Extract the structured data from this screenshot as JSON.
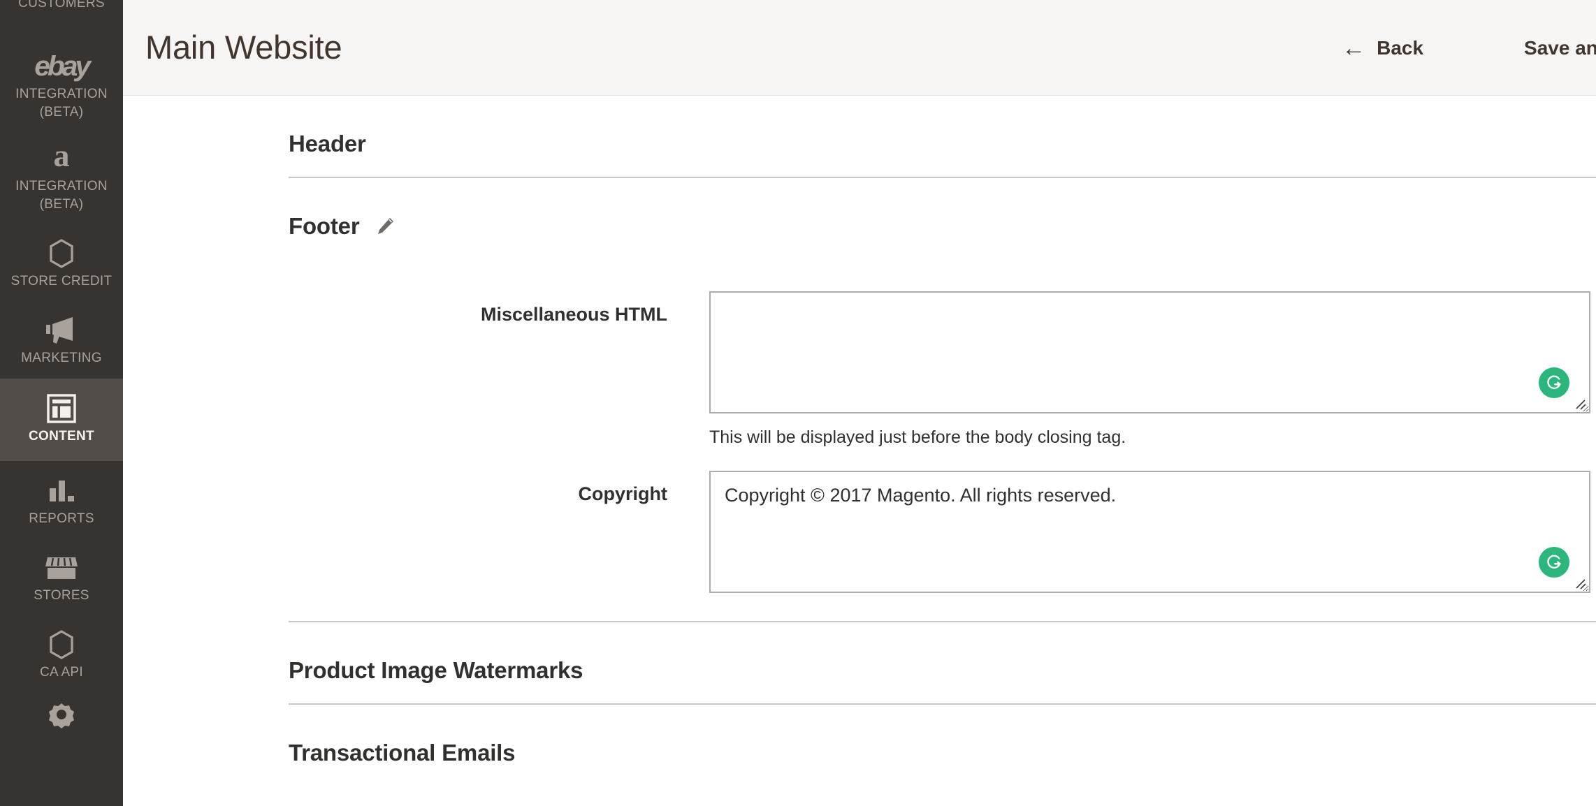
{
  "sidebar": {
    "items": [
      {
        "label": "CUSTOMERS",
        "icon": "customers-icon",
        "active": false,
        "partial_top": true
      },
      {
        "label": "INTEGRATION\n(BETA)",
        "icon": "ebay-logo-icon",
        "active": false
      },
      {
        "label": "INTEGRATION\n(BETA)",
        "icon": "amazon-logo-icon",
        "active": false
      },
      {
        "label": "STORE CREDIT",
        "icon": "hexagon-icon",
        "active": false
      },
      {
        "label": "MARKETING",
        "icon": "megaphone-icon",
        "active": false
      },
      {
        "label": "CONTENT",
        "icon": "content-layout-icon",
        "active": true
      },
      {
        "label": "REPORTS",
        "icon": "bar-chart-icon",
        "active": false
      },
      {
        "label": "STORES",
        "icon": "storefront-icon",
        "active": false
      },
      {
        "label": "CA API",
        "icon": "hexagon-icon",
        "active": false
      },
      {
        "label": "",
        "icon": "gear-icon",
        "active": false,
        "partial_bottom": true
      }
    ],
    "ebay_mark": "ebay",
    "amazon_mark": "a"
  },
  "header": {
    "title": "Main Website",
    "back_label": "Back",
    "back_icon": "arrow-left-icon",
    "save_label": "Save and C"
  },
  "content": {
    "sections": [
      {
        "id": "header",
        "title": "Header",
        "has_edit": false
      },
      {
        "id": "footer",
        "title": "Footer",
        "has_edit": true,
        "edit_icon": "pencil-icon"
      },
      {
        "id": "watermarks",
        "title": "Product Image Watermarks",
        "has_edit": false
      },
      {
        "id": "emails",
        "title": "Transactional Emails",
        "has_edit": false
      }
    ],
    "footer_fields": {
      "misc_html": {
        "label": "Miscellaneous HTML",
        "value": "",
        "note": "This will be displayed just before the body closing tag.",
        "badge_icon": "grammarly-icon"
      },
      "copyright": {
        "label": "Copyright",
        "value": "Copyright © 2017 Magento. All rights reserved.",
        "badge_icon": "grammarly-icon"
      }
    }
  },
  "colors": {
    "sidebar_bg": "#373330",
    "sidebar_active_bg": "#524d48",
    "sidebar_text": "#a9a29c",
    "header_bg": "#f7f5f4",
    "text_dark": "#30302f",
    "title_color": "#41362f",
    "border": "#adadad",
    "divider": "#c8c8c8",
    "grammarly_green": "#2cb67d"
  }
}
